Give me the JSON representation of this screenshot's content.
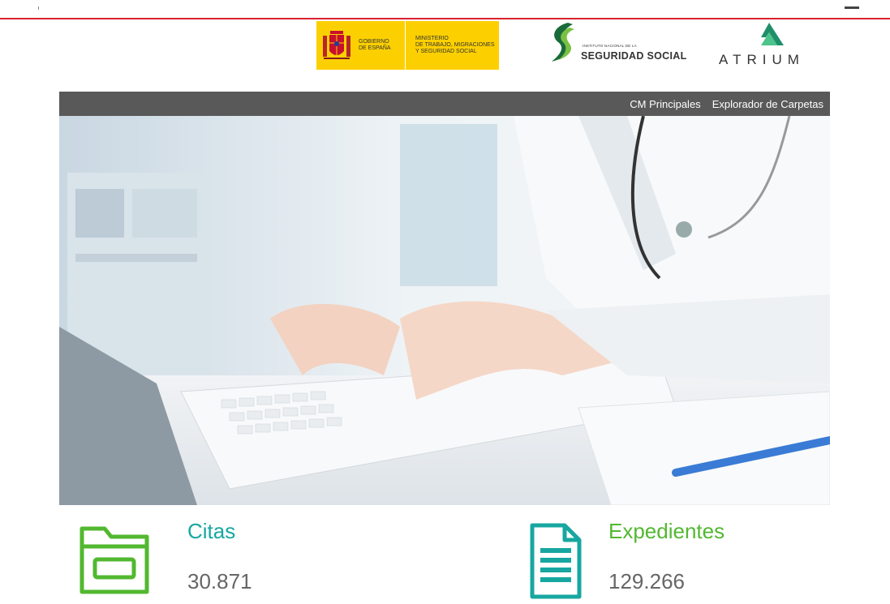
{
  "header": {
    "gobierno_line1": "GOBIERNO",
    "gobierno_line2": "DE ESPAÑA",
    "ministerio_line1": "MINISTERIO",
    "ministerio_line2": "DE TRABAJO, MIGRACIONES",
    "ministerio_line3": "Y SEGURIDAD SOCIAL",
    "ss_small": "INSTITUTO NACIONAL DE LA",
    "ss_big": "SEGURIDAD SOCIAL",
    "atrium": "ATRIUM"
  },
  "nav": {
    "items": [
      {
        "label": "CM Principales"
      },
      {
        "label": "Explorador de Carpetas"
      }
    ]
  },
  "stats": {
    "citas": {
      "title": "Citas",
      "value": "30.871",
      "icon": "folder-icon"
    },
    "expedientes": {
      "title": "Expedientes",
      "value": "129.266",
      "icon": "document-icon"
    }
  },
  "colors": {
    "accent_red": "#d9232e",
    "gob_yellow": "#fcd000",
    "nav_bg": "#595959",
    "citas_teal": "#17a7a0",
    "expedientes_green": "#52b830"
  }
}
